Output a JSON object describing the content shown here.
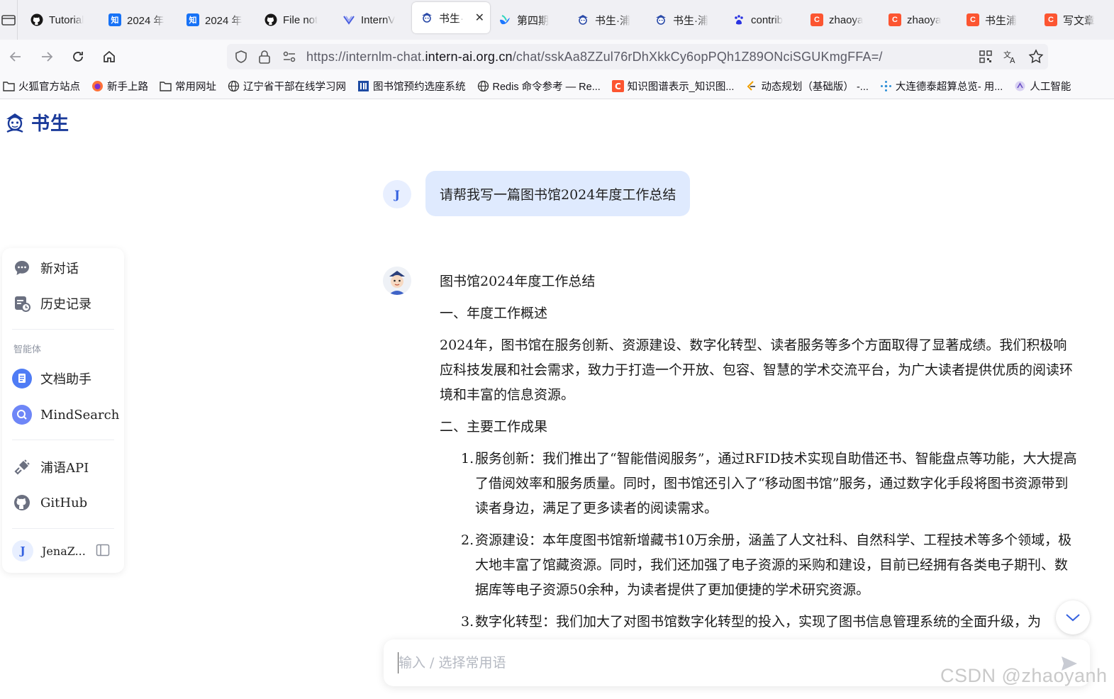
{
  "browser": {
    "tabs": [
      {
        "title": "Tutorial",
        "icon": "github-icon",
        "color": "#181717"
      },
      {
        "title": "2024 年",
        "icon": "zhihu-icon",
        "color": "#1772f6"
      },
      {
        "title": "2024 年",
        "icon": "zhihu-icon",
        "color": "#1772f6"
      },
      {
        "title": "File not",
        "icon": "github-icon",
        "color": "#181717"
      },
      {
        "title": "InternV",
        "icon": "internvl-icon",
        "color": "#4a5fe0"
      },
      {
        "title": "书生·",
        "icon": "shusheng-icon",
        "color": "#2a4aa8",
        "active": true
      },
      {
        "title": "第四期",
        "icon": "feishu-icon",
        "color": "#1c77ff"
      },
      {
        "title": "书生·浦",
        "icon": "shusheng-icon",
        "color": "#2a4aa8"
      },
      {
        "title": "书生·浦",
        "icon": "shusheng-icon",
        "color": "#2a4aa8"
      },
      {
        "title": "contrib",
        "icon": "baidu-paw-icon",
        "color": "#2932e1"
      },
      {
        "title": "zhaoya",
        "icon": "csdn-icon",
        "color": "#fc5531"
      },
      {
        "title": "zhaoya",
        "icon": "csdn-icon",
        "color": "#fc5531"
      },
      {
        "title": "书生浦",
        "icon": "csdn-icon",
        "color": "#fc5531"
      },
      {
        "title": "写文章",
        "icon": "csdn-icon",
        "color": "#fc5531"
      }
    ],
    "url_prefix": "https://internlm-chat.",
    "url_domain": "intern-ai.org.cn",
    "url_suffix": "/chat/sskAa8ZZul76rDhXkkCy6opPQh1Z89ONciSGUKmgFFA=/",
    "bookmarks": [
      {
        "label": "火狐官方站点",
        "icon": "folder-icon"
      },
      {
        "label": "新手上路",
        "icon": "firefox-icon"
      },
      {
        "label": "常用网址",
        "icon": "folder-icon"
      },
      {
        "label": "辽宁省干部在线学习网",
        "icon": "globe-icon"
      },
      {
        "label": "图书馆预约选座系统",
        "icon": "library-icon"
      },
      {
        "label": "Redis 命令参考 — Re...",
        "icon": "globe-icon"
      },
      {
        "label": "知识图谱表示_知识图...",
        "icon": "csdn-icon"
      },
      {
        "label": "动态规划（基础版） -...",
        "icon": "leetcode-icon"
      },
      {
        "label": "大连德泰超算总览- 用...",
        "icon": "sparkle-icon"
      },
      {
        "label": "人工智能",
        "icon": "ai-icon"
      }
    ]
  },
  "app": {
    "logo_text": "书生"
  },
  "sidebar": {
    "new_chat": "新对话",
    "history": "历史记录",
    "section_label": "智能体",
    "doc_assistant": "文档助手",
    "mindsearch": "MindSearch",
    "api": "浦语API",
    "github": "GitHub",
    "user_initial": "J",
    "user_name": "JenaZ..."
  },
  "conversation": {
    "user_initial": "J",
    "user_message": "请帮我写一篇图书馆2024年度工作总结",
    "answer": {
      "title": "图书馆2024年度工作总结",
      "section1": "一、年度工作概述",
      "overview": "2024年，图书馆在服务创新、资源建设、数字化转型、读者服务等多个方面取得了显著成绩。我们积极响应科技发展和社会需求，致力于打造一个开放、包容、智慧的学术交流平台，为广大读者提供优质的阅读环境和丰富的信息资源。",
      "section2": "二、主要工作成果",
      "items": [
        {
          "num": "1.",
          "text": "服务创新：我们推出了“智能借阅服务”，通过RFID技术实现自助借还书、智能盘点等功能，大大提高了借阅效率和服务质量。同时，图书馆还引入了“移动图书馆”服务，通过数字化手段将图书资源带到读者身边，满足了更多读者的阅读需求。"
        },
        {
          "num": "2.",
          "text": "资源建设：本年度图书馆新增藏书10万余册，涵盖了人文社科、自然科学、工程技术等多个领域，极大地丰富了馆藏资源。同时，我们还加强了电子资源的采购和建设，目前已经拥有各类电子期刊、数据库等电子资源50余种，为读者提供了更加便捷的学术研究资源。"
        },
        {
          "num": "3.",
          "text": "数字化转型：我们加大了对图书馆数字化转型的投入，实现了图书信息管理系统的全面升级，为"
        }
      ]
    }
  },
  "input": {
    "placeholder": "输入 / 选择常用语"
  },
  "watermark": "CSDN @zhaoyanh",
  "colors": {
    "accent": "#3461e0",
    "user_bubble": "#dfeafe",
    "logo": "#1a3a9a"
  }
}
